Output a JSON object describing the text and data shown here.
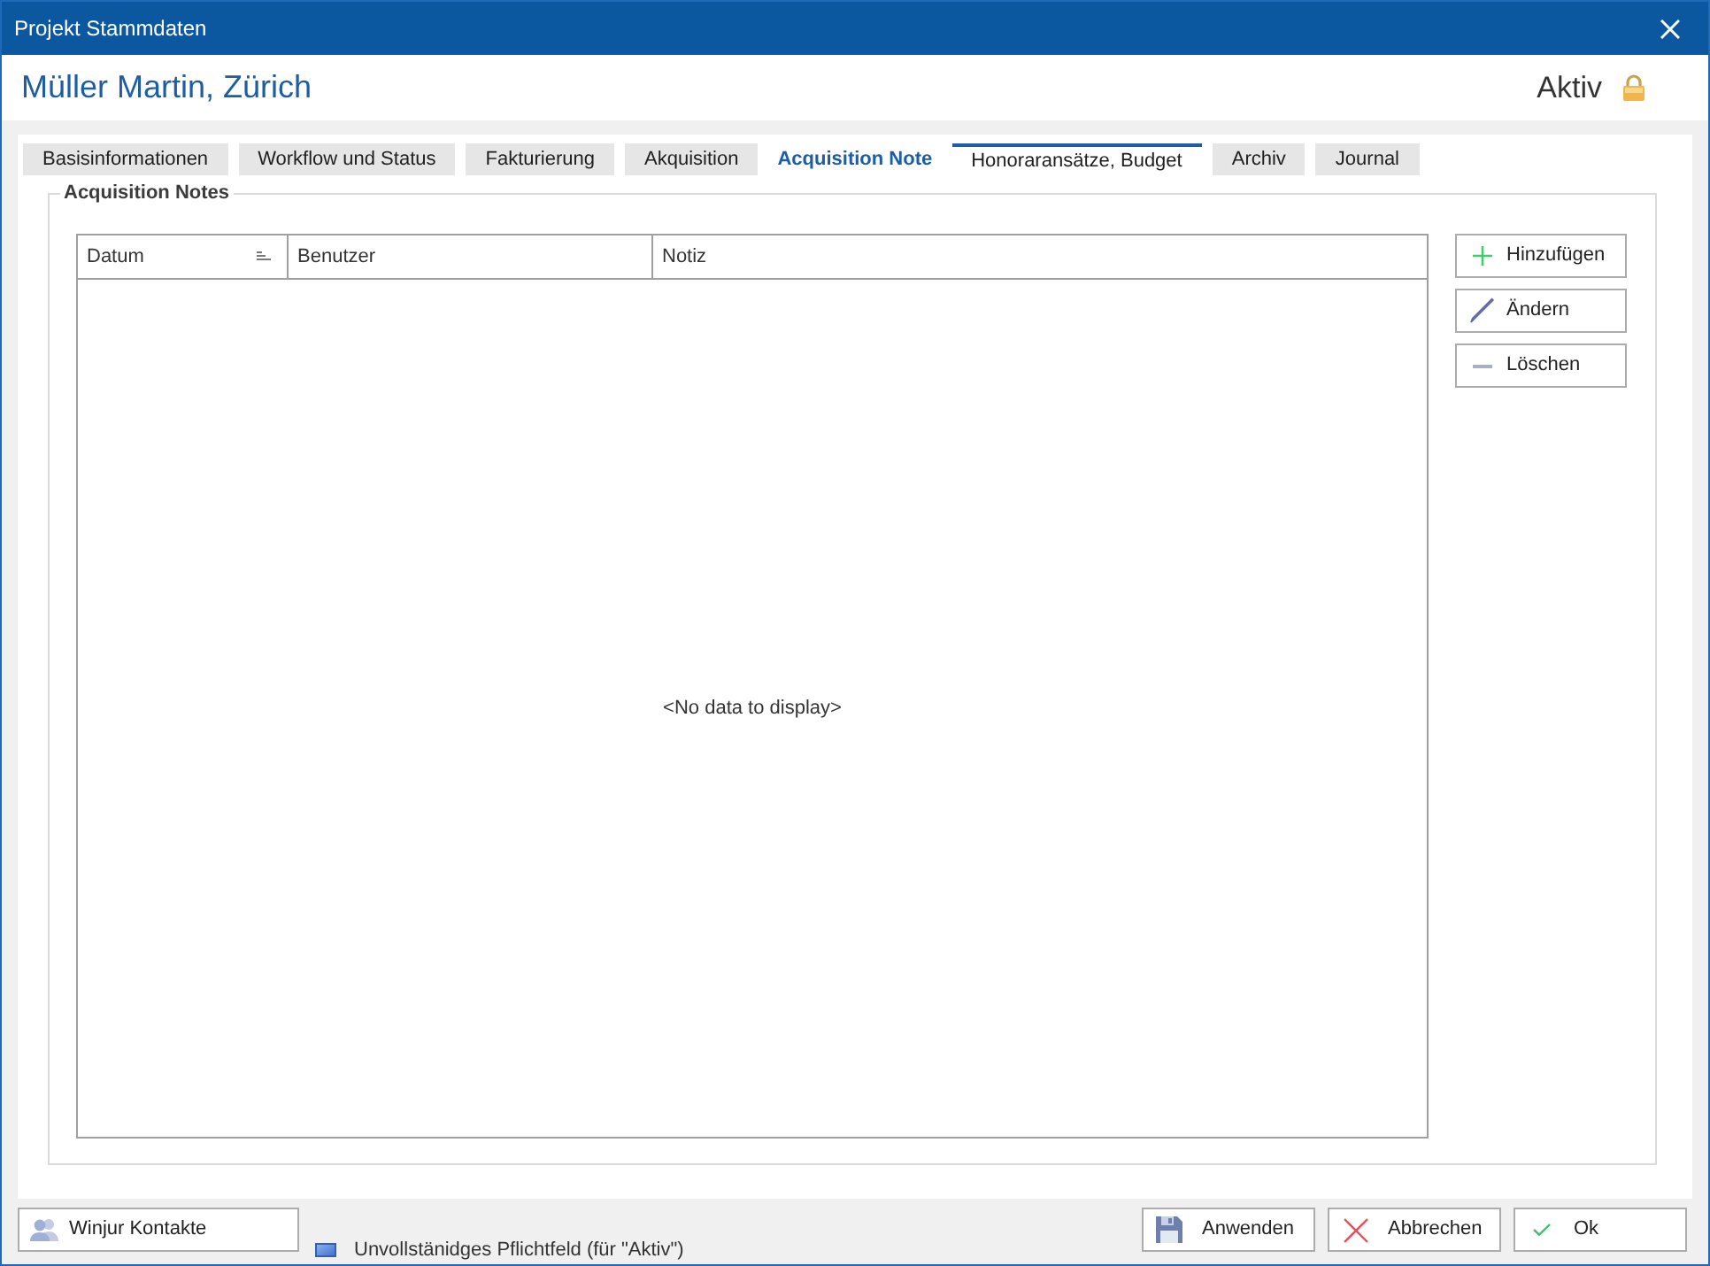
{
  "window": {
    "title": "Projekt Stammdaten"
  },
  "header": {
    "name": "Müller Martin, Zürich",
    "status": "Aktiv",
    "locked": true
  },
  "tabs": [
    {
      "label": "Basisinformationen",
      "selected": false,
      "hovered": false
    },
    {
      "label": "Workflow und Status",
      "selected": false,
      "hovered": false
    },
    {
      "label": "Fakturierung",
      "selected": false,
      "hovered": false
    },
    {
      "label": "Akquisition",
      "selected": false,
      "hovered": false
    },
    {
      "label": "Acquisition Note",
      "selected": true,
      "hovered": false
    },
    {
      "label": "Honoraransätze, Budget",
      "selected": false,
      "hovered": true
    },
    {
      "label": "Archiv",
      "selected": false,
      "hovered": false
    },
    {
      "label": "Journal",
      "selected": false,
      "hovered": false
    }
  ],
  "group": {
    "title": "Acquisition Notes"
  },
  "table": {
    "columns": [
      {
        "label": "Datum",
        "sorted": true
      },
      {
        "label": "Benutzer",
        "sorted": false
      },
      {
        "label": "Notiz",
        "sorted": false
      }
    ],
    "empty_text": "<No data to display>"
  },
  "side_buttons": [
    {
      "kind": "add",
      "label": "Hinzufügen"
    },
    {
      "kind": "edit",
      "label": "Ändern"
    },
    {
      "kind": "delete",
      "label": "Löschen"
    }
  ],
  "footer": {
    "contacts_button": "Winjur Kontakte",
    "legend": "Unvollstänidges Pflichtfeld (für \"Aktiv\")",
    "buttons": [
      {
        "kind": "apply",
        "label": "Anwenden"
      },
      {
        "kind": "cancel",
        "label": "Abbrechen"
      },
      {
        "kind": "ok",
        "label": "Ok"
      }
    ]
  }
}
